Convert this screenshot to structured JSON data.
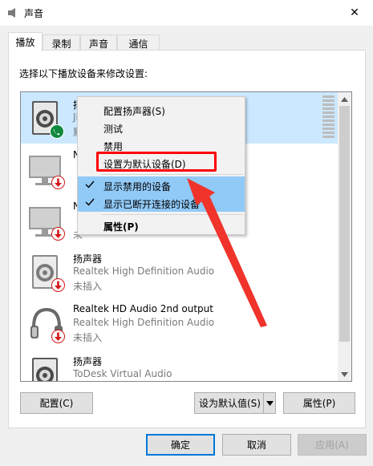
{
  "window": {
    "title": "声音",
    "icon": "speaker-icon",
    "close_glyph": "✕"
  },
  "tabs": [
    {
      "label": "播放",
      "active": true
    },
    {
      "label": "录制",
      "active": false
    },
    {
      "label": "声音",
      "active": false
    },
    {
      "label": "通信",
      "active": false
    }
  ],
  "instruction": "选择以下播放设备来修改设置:",
  "devices": [
    {
      "name": "扬",
      "desc": "Ji",
      "status": "默",
      "icon": "speaker-icon",
      "badge": "default-phone-badge",
      "selected": true
    },
    {
      "name": "N",
      "desc": "",
      "status": "",
      "icon": "monitor-icon",
      "badge": "disconnected-badge",
      "selected": false
    },
    {
      "name": "N",
      "desc": "",
      "status": "未",
      "icon": "monitor-icon",
      "badge": "disconnected-badge",
      "selected": false
    },
    {
      "name": "扬声器",
      "desc": "Realtek High Definition Audio",
      "status": "未插入",
      "icon": "speaker-icon",
      "badge": "disconnected-badge",
      "selected": false
    },
    {
      "name": "Realtek HD Audio 2nd output",
      "desc": "Realtek High Definition Audio",
      "status": "未插入",
      "icon": "headphones-icon",
      "badge": "disconnected-badge",
      "selected": false
    },
    {
      "name": "扬声器",
      "desc": "ToDesk Virtual Audio",
      "status": "",
      "icon": "speaker-icon",
      "badge": "disconnected-badge",
      "selected": false
    }
  ],
  "context_menu": {
    "items": [
      {
        "label": "配置扬声器(S)",
        "checked": false,
        "bold": false
      },
      {
        "label": "测试",
        "checked": false,
        "bold": false
      },
      {
        "label": "禁用",
        "checked": false,
        "bold": false
      },
      {
        "label": "设置为默认设备(D)",
        "checked": false,
        "bold": false,
        "highlighted": true
      },
      {
        "label": "显示禁用的设备",
        "checked": true,
        "bold": false
      },
      {
        "label": "显示已断开连接的设备",
        "checked": true,
        "bold": false
      },
      {
        "label": "属性(P)",
        "checked": false,
        "bold": true
      }
    ]
  },
  "buttons": {
    "configure": "配置(C)",
    "set_default": "设为默认值(S)",
    "properties": "属性(P)",
    "ok": "确定",
    "cancel": "取消",
    "apply": "应用(A)"
  },
  "colors": {
    "selection": "#cce8ff",
    "menu_check_bg": "#91c9f7",
    "annotation_red": "#ff0000",
    "arrow_red": "#f0342c",
    "default_badge_green": "#10893e",
    "disconnected_badge_red": "#d41919"
  }
}
